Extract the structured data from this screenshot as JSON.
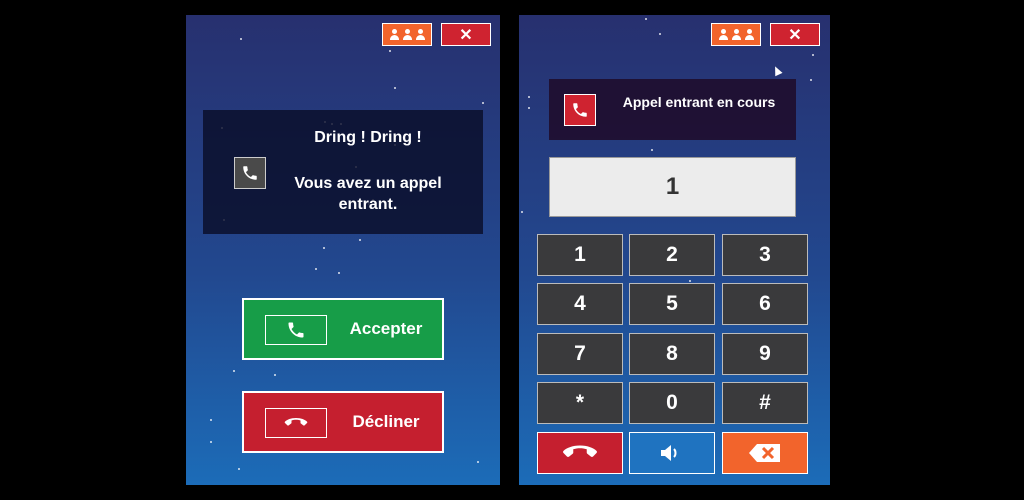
{
  "left_panel": {
    "title": "Dring ! Dring !",
    "message": "Vous avez un appel entrant.",
    "accept_label": "Accepter",
    "decline_label": "Décliner",
    "close_glyph": "✕",
    "icons": [
      "contacts-icon",
      "close-icon",
      "phone-icon",
      "phone-accept-icon",
      "phone-hangup-icon"
    ]
  },
  "right_panel": {
    "status": "Appel entrant en cours",
    "display_value": "1",
    "close_glyph": "✕",
    "keys": [
      "1",
      "2",
      "3",
      "4",
      "5",
      "6",
      "7",
      "8",
      "9",
      "*",
      "0",
      "#"
    ],
    "icons": [
      "contacts-icon",
      "close-icon",
      "phone-icon",
      "phone-hangup-icon",
      "speaker-icon",
      "backspace-icon"
    ]
  },
  "colors": {
    "accent_orange": "#f2642c",
    "close_red": "#cf2330",
    "accept_green": "#179d48",
    "decline_red": "#c51f2f",
    "speaker_blue": "#1f73c0",
    "key_dark": "#3a3a3c"
  }
}
